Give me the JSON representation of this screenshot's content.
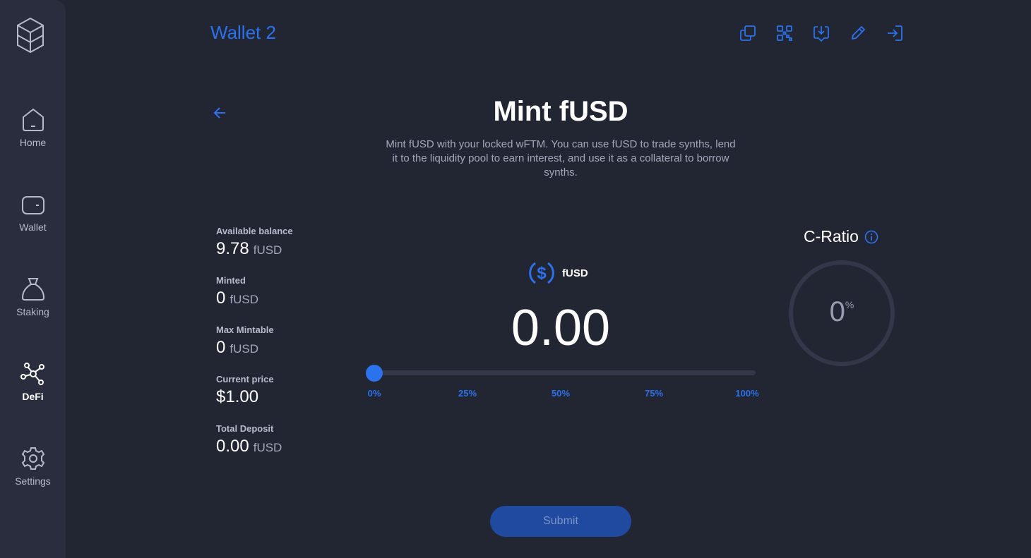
{
  "header": {
    "wallet_title": "Wallet 2",
    "icons": [
      "copy-icon",
      "qr-code-icon",
      "download-icon",
      "edit-icon",
      "logout-icon"
    ]
  },
  "sidebar": {
    "items": [
      {
        "label": "Home",
        "icon": "home-icon",
        "active": false
      },
      {
        "label": "Wallet",
        "icon": "wallet-icon",
        "active": false
      },
      {
        "label": "Staking",
        "icon": "staking-bag-icon",
        "active": false
      },
      {
        "label": "DeFi",
        "icon": "defi-network-icon",
        "active": true
      },
      {
        "label": "Settings",
        "icon": "gear-icon",
        "active": false
      }
    ]
  },
  "page": {
    "title": "Mint fUSD",
    "description": "Mint fUSD with your locked wFTM. You can use fUSD to trade synths, lend it to the liquidity pool to earn interest, and use it as a collateral to borrow synths."
  },
  "stats": [
    {
      "label": "Available balance",
      "value": "9.78",
      "unit": "fUSD"
    },
    {
      "label": "Minted",
      "value": "0",
      "unit": "fUSD"
    },
    {
      "label": "Max Mintable",
      "value": "0",
      "unit": "fUSD"
    },
    {
      "label": "Current price",
      "value": "$1.00",
      "unit": ""
    },
    {
      "label": "Total Deposit",
      "value": "0.00",
      "unit": "fUSD"
    }
  ],
  "mint": {
    "token": "fUSD",
    "amount": "0.00",
    "slider_percent": 0,
    "marks": [
      "0%",
      "25%",
      "50%",
      "75%",
      "100%"
    ]
  },
  "cratio": {
    "title": "C-Ratio",
    "value": "0",
    "unit": "%"
  },
  "submit_label": "Submit",
  "colors": {
    "accent": "#2b72ec",
    "background": "#222532",
    "sidebar": "#2a2d3e",
    "submit_bg": "#1f4aa0"
  }
}
